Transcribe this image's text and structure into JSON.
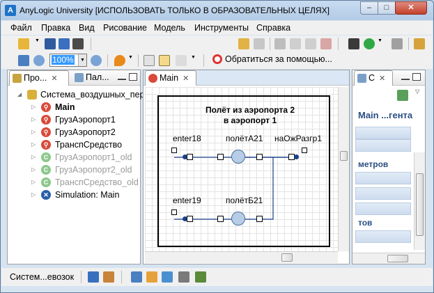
{
  "window": {
    "title": "AnyLogic University [ИСПОЛЬЗОВАТЬ ТОЛЬКО В ОБРАЗОВАТЕЛЬНЫХ ЦЕЛЯХ]",
    "controls": {
      "minimize": "–",
      "maximize": "□",
      "close": "✕"
    }
  },
  "menu": [
    "Файл",
    "Правка",
    "Вид",
    "Рисование",
    "Модель",
    "Инструменты",
    "Справка"
  ],
  "toolbar": {
    "zoom_value": "100%",
    "help_label": "Обратиться за помощью..."
  },
  "project_panel": {
    "tabs": [
      {
        "label": "Про..."
      },
      {
        "label": "Пал..."
      }
    ],
    "root": "Система_воздушных_пер",
    "items": [
      {
        "label": "Main",
        "bold": true,
        "icon": "agent-icon",
        "color": "#d94a3a"
      },
      {
        "label": "ГрузАэропорт1",
        "icon": "agent-icon",
        "color": "#d94a3a"
      },
      {
        "label": "ГрузАэропорт2",
        "icon": "agent-icon",
        "color": "#d94a3a"
      },
      {
        "label": "ТранспСредство",
        "icon": "agent-icon",
        "color": "#d94a3a"
      },
      {
        "label": "ГрузАэропорт1_old",
        "icon": "class-icon",
        "color": "#8cc88c",
        "grey": true
      },
      {
        "label": "ГрузАэропорт2_old",
        "icon": "class-icon",
        "color": "#8cc88c",
        "grey": true
      },
      {
        "label": "ТранспСредство_old",
        "icon": "class-icon",
        "color": "#8cc88c",
        "grey": true
      },
      {
        "label": "Simulation: Main",
        "icon": "experiment-icon",
        "color": "#2a5fa8"
      }
    ]
  },
  "editor": {
    "tab_label": "Main",
    "diagram": {
      "title_line1": "Полёт из аэропорта 2",
      "title_line2": "в аэропорт 1",
      "labels": {
        "enter18": "enter18",
        "enter19": "enter19",
        "flightA": "полётА21",
        "flightB": "полётБ21",
        "sink": "наОжРазгр1"
      }
    }
  },
  "props_panel": {
    "tab_label": "С",
    "title": "Main ...гента",
    "row1": "метров",
    "row2": "тов"
  },
  "status": {
    "text": "Систем...евозок"
  }
}
